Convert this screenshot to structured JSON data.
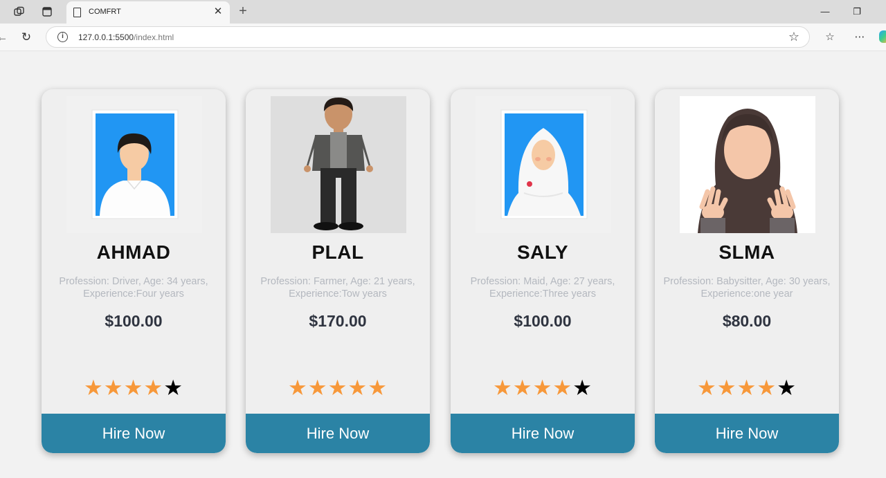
{
  "browser": {
    "tab_title": "COMFRT",
    "tab_close": "✕",
    "new_tab": "+",
    "url_host": "127.0.0.1:5500",
    "url_path": "/index.html",
    "icons": [
      "workspaces-icon",
      "tab-actions-icon",
      "page-icon",
      "refresh-icon",
      "info-icon",
      "favorite-star-icon",
      "favorites-icon",
      "more-icon",
      "copilot-icon"
    ]
  },
  "cards": [
    {
      "name": "AHMAD",
      "desc_line1": "Profession: Driver, Age: 34 years,",
      "desc_line2": "Experience:Four years",
      "price": "$100.00",
      "rating": 4,
      "button": "Hire Now"
    },
    {
      "name": "PLAL",
      "desc_line1": "Profession: Farmer, Age: 21 years,",
      "desc_line2": "Experience:Tow years",
      "price": "$170.00",
      "rating": 5,
      "button": "Hire Now"
    },
    {
      "name": "SALY",
      "desc_line1": "Profession: Maid, Age: 27 years,",
      "desc_line2": "Experience:Three years",
      "price": "$100.00",
      "rating": 4,
      "button": "Hire Now"
    },
    {
      "name": "SLMA",
      "desc_line1": "Profession: Babysitter, Age: 30 years,",
      "desc_line2": "Experience:one year",
      "price": "$80.00",
      "rating": 4,
      "button": "Hire Now"
    }
  ],
  "colors": {
    "page_bg": "#f2f2f2",
    "button_bg": "#2b83a5",
    "star_on": "#f7983a",
    "star_off": "#000000",
    "photo_bg_blue": "#2196f3"
  }
}
